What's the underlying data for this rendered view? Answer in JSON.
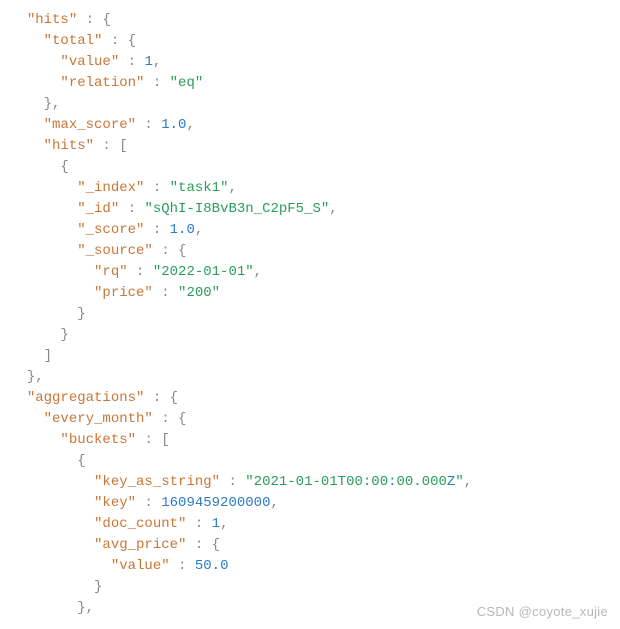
{
  "watermark": "CSDN @coyote_xujie",
  "tokens": {
    "hits": "\"hits\"",
    "total": "\"total\"",
    "value": "\"value\"",
    "relation": "\"relation\"",
    "max_score": "\"max_score\"",
    "index": "\"_index\"",
    "id": "\"_id\"",
    "score": "\"_score\"",
    "source": "\"_source\"",
    "rq": "\"rq\"",
    "price": "\"price\"",
    "aggregations": "\"aggregations\"",
    "every_month": "\"every_month\"",
    "buckets": "\"buckets\"",
    "key_as_string": "\"key_as_string\"",
    "key": "\"key\"",
    "doc_count": "\"doc_count\"",
    "avg_price": "\"avg_price\""
  },
  "values": {
    "num_1": "1",
    "str_eq": "\"eq\"",
    "num_1_0": "1.0",
    "str_task1": "\"task1\"",
    "str_id": "\"sQhI-I8BvB3n_C2pF5_S\"",
    "str_date1": "\"2022-01-01\"",
    "str_200": "\"200\"",
    "str_iso_pre": "\"2021-01-01T00:00:00.000",
    "str_iso_z": "Z",
    "str_iso_post": "\"",
    "num_key": "1609459200000",
    "num_50_0": "50.0"
  },
  "chart_data": {
    "type": "table",
    "title": "Elasticsearch JSON response fragment",
    "hits": {
      "total": {
        "value": 1,
        "relation": "eq"
      },
      "max_score": 1.0,
      "hits": [
        {
          "_index": "task1",
          "_id": "sQhI-I8BvB3n_C2pF5_S",
          "_score": 1.0,
          "_source": {
            "rq": "2022-01-01",
            "price": "200"
          }
        }
      ]
    },
    "aggregations": {
      "every_month": {
        "buckets": [
          {
            "key_as_string": "2021-01-01T00:00:00.000Z",
            "key": 1609459200000,
            "doc_count": 1,
            "avg_price": {
              "value": 50.0
            }
          }
        ]
      }
    }
  }
}
